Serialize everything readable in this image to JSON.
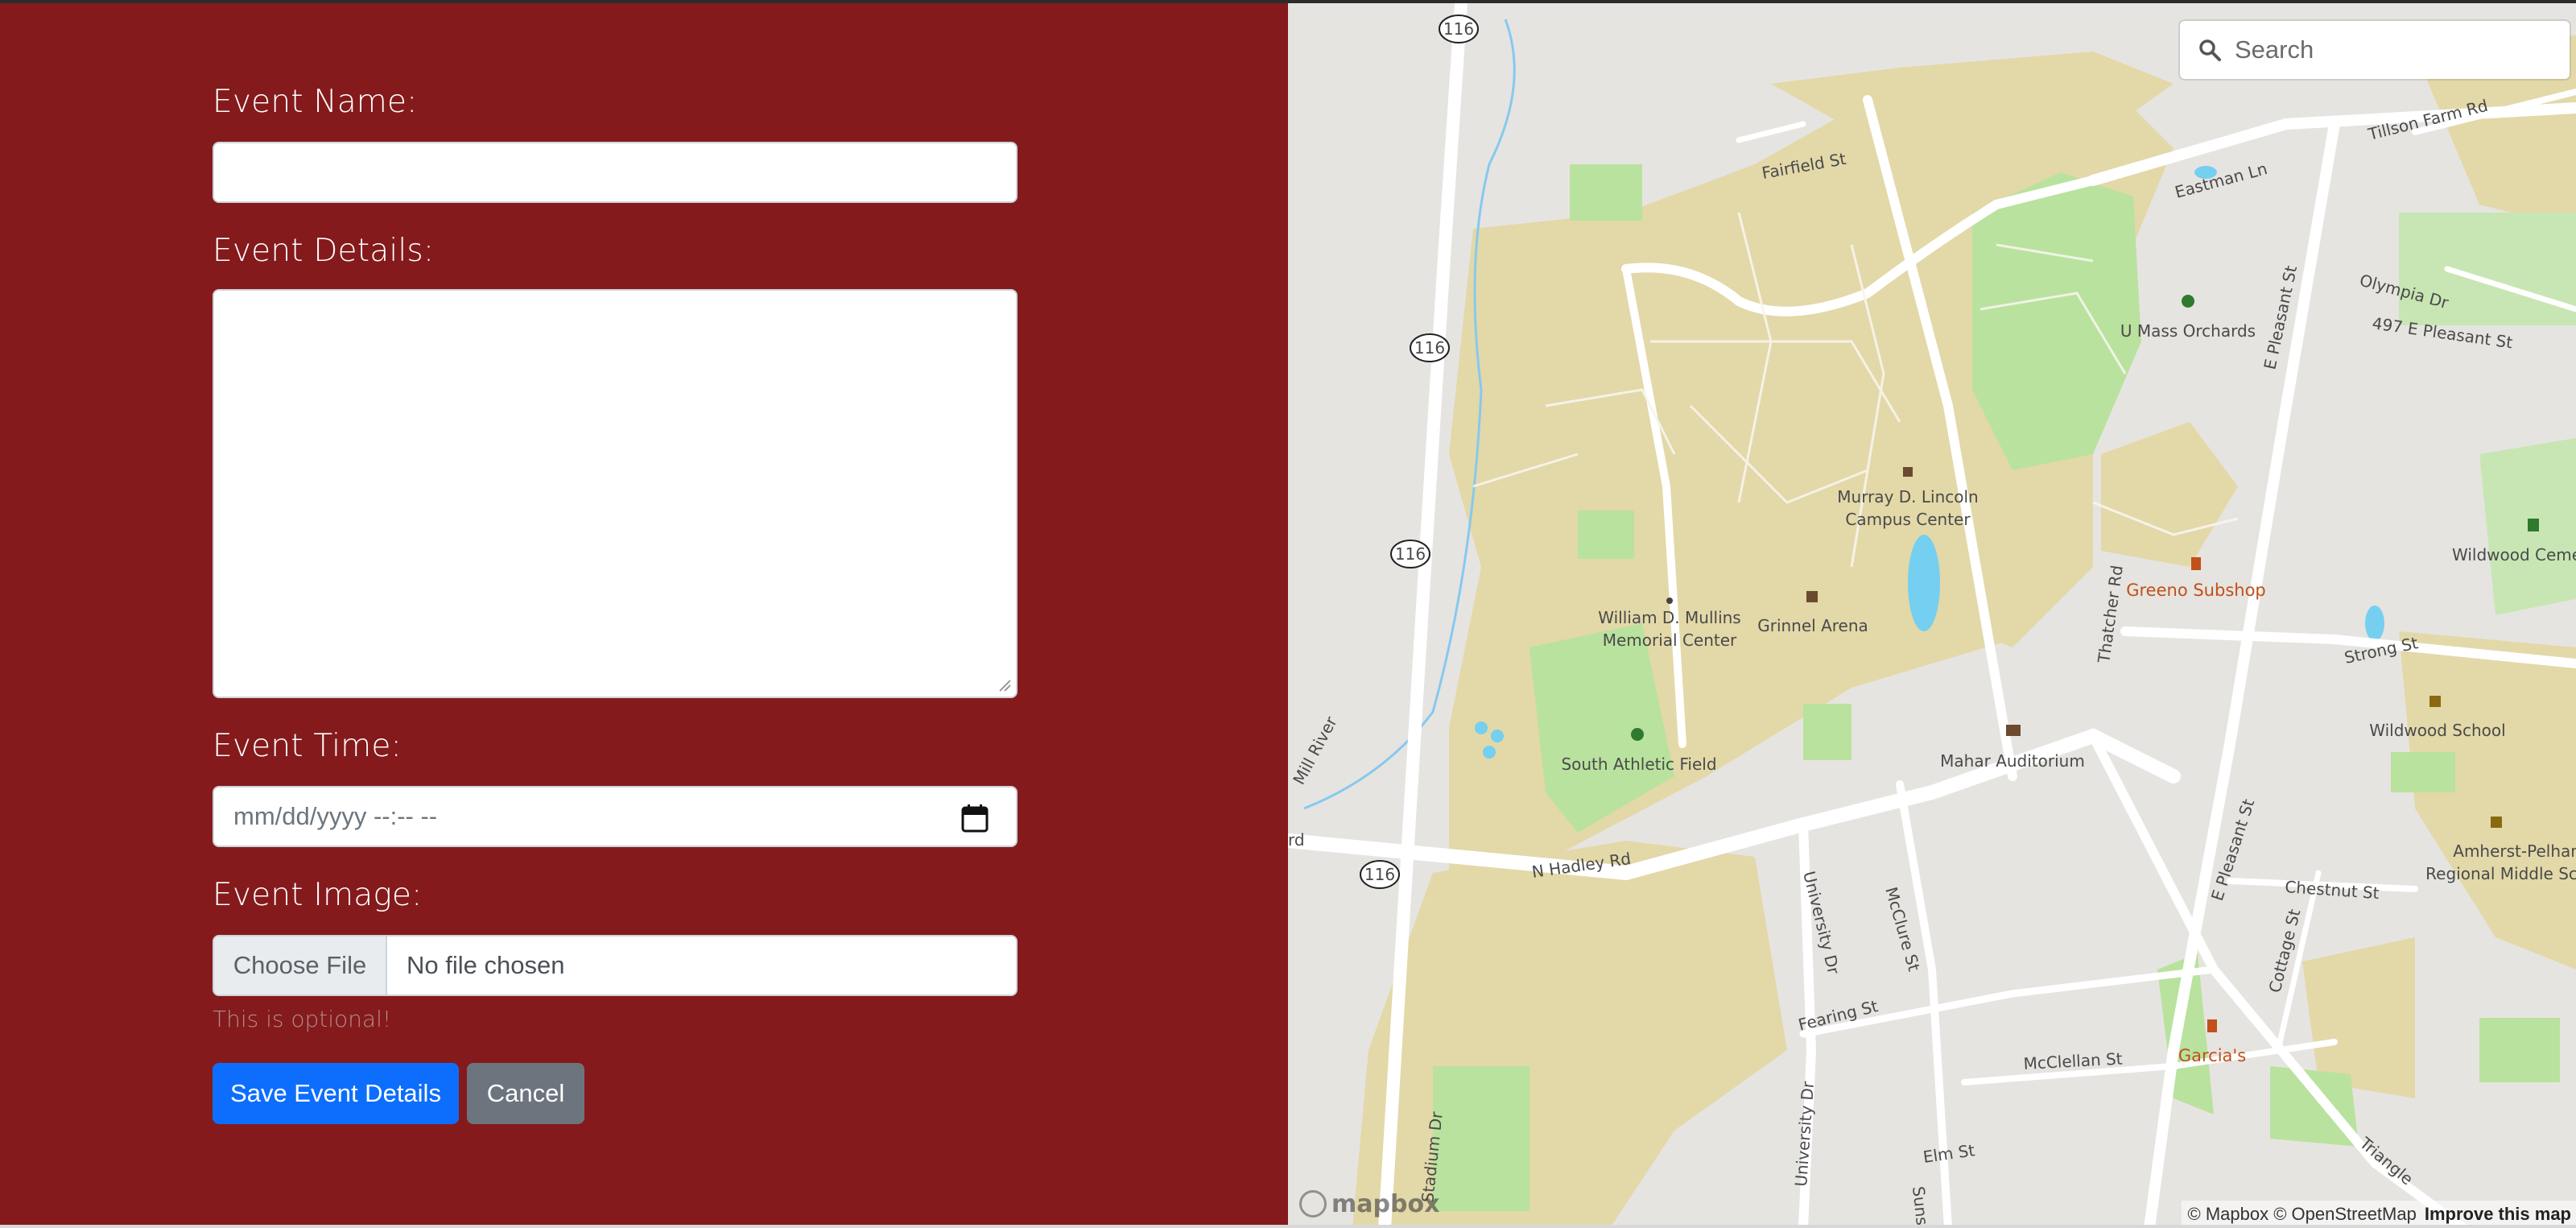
{
  "form": {
    "event_name_label": "Event Name:",
    "event_name_value": "",
    "event_details_label": "Event Details:",
    "event_details_value": "",
    "event_time_label": "Event Time:",
    "event_time_placeholder": "mm/dd/yyyy --:-- --",
    "event_image_label": "Event Image:",
    "choose_file_label": "Choose File",
    "file_status": "No file chosen",
    "file_help": "This is optional!",
    "save_label": "Save Event Details",
    "cancel_label": "Cancel"
  },
  "map": {
    "search_placeholder": "Search",
    "attribution": "© Mapbox © OpenStreetMap",
    "improve_link": "Improve this map",
    "logo_text": "mapbox",
    "places": {
      "campus_center": [
        "Murray D. Lincoln",
        "Campus Center"
      ],
      "mullins_center": [
        "William D. Mullins",
        "Memorial Center"
      ],
      "grinnel_arena": "Grinnel Arena",
      "south_athletic_field": "South Athletic Field",
      "mahar_auditorium": "Mahar Auditorium",
      "umass_orchards": "U Mass Orchards",
      "greeno_subshop": "Greeno Subshop",
      "wildwood_school": "Wildwood School",
      "wildwood_cemetery": "Wildwood Ceme",
      "amherst_pelham": [
        "Amherst-Pelham",
        "Regional Middle Scho"
      ],
      "garcias": "Garcia's",
      "mill_river": "Mill River"
    },
    "streets": {
      "fairfield": "Fairfield St",
      "eastman": "Eastman Ln",
      "tillson": "Tillson Farm Rd",
      "olympia": "Olympia Dr",
      "e_pleasant_497": "497 E Pleasant St",
      "e_pleasant_top": "E Pleasant St",
      "e_pleasant_bottom": "E Pleasant St",
      "strong": "Strong St",
      "n_hadley": "N Hadley Rd",
      "university_top": "University Dr",
      "university_bottom": "University Dr",
      "mcclure": "McClure St",
      "fearing": "Fearing St",
      "mcclellan": "McClellan St",
      "chestnut": "Chestnut St",
      "cottage": "Cottage St",
      "thatcher": "Thatcher Rd",
      "elm": "Elm St",
      "triangle": "Triangle",
      "stadium": "Stadium Dr",
      "sunset": "Sunset",
      "left_edge_rd": "rd"
    },
    "route_shield": "116"
  },
  "colors": {
    "panel_bg": "#841a1c",
    "primary_button": "#0d6efd",
    "secondary_button": "#6c757d",
    "campus_fill": "#e3d8a8",
    "park_fill": "#b9e29e",
    "water": "#75cff0"
  }
}
